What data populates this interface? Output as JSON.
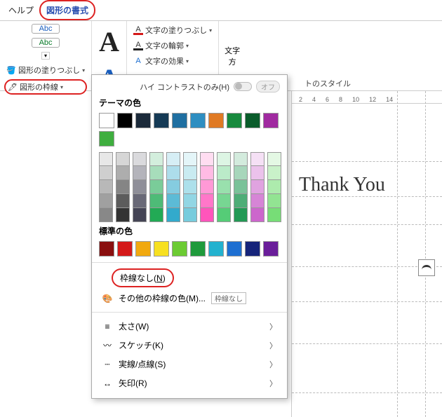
{
  "tabs": {
    "help": "ヘルプ",
    "shape_format": "図形の書式"
  },
  "ribbon": {
    "abc1": "Abc",
    "abc2": "Abc",
    "fill": "図形の塗りつぶし",
    "outline": "図形の枠線",
    "wa_styles_label": "トのスタイル",
    "text_fill": "文字の塗りつぶし",
    "text_outline": "文字の輪郭",
    "text_effects": "文字の効果",
    "vtext": "文字\n方"
  },
  "panel": {
    "contrast_label": "ハイ コントラストのみ(H)",
    "contrast_off": "オフ",
    "theme_title": "テーマの色",
    "theme_row": [
      "#ffffff",
      "#000000",
      "#1b2a3a",
      "#153a55",
      "#1f6fa1",
      "#2e8ec1",
      "#e07a24",
      "#188a3e",
      "#0a5c2b",
      "#a02aa0",
      "#3fae3f"
    ],
    "grad_bases": [
      "#888",
      "#333",
      "#445",
      "#2a5",
      "#3ac",
      "#7cd",
      "#f5b",
      "#5c7",
      "#295",
      "#c6c",
      "#7d7"
    ],
    "std_title": "標準の色",
    "std_row": [
      "#8a0f0f",
      "#d41919",
      "#f1a90f",
      "#f7e021",
      "#6ccb33",
      "#1f9a3c",
      "#23b2cf",
      "#1e6fd1",
      "#16247a",
      "#6a1e9a"
    ],
    "no_outline": "枠線なし(N)",
    "no_outline_u": "N",
    "more_colors": "その他の枠線の色(M)...",
    "more_colors_tag": "枠線なし",
    "weight": "太さ(W)",
    "sketch": "スケッチ(K)",
    "dashes": "実線/点線(S)",
    "arrows": "矢印(R)"
  },
  "doc": {
    "ruler": [
      "2",
      "4",
      "6",
      "8",
      "10",
      "12",
      "14"
    ],
    "thank": "Thank You"
  }
}
